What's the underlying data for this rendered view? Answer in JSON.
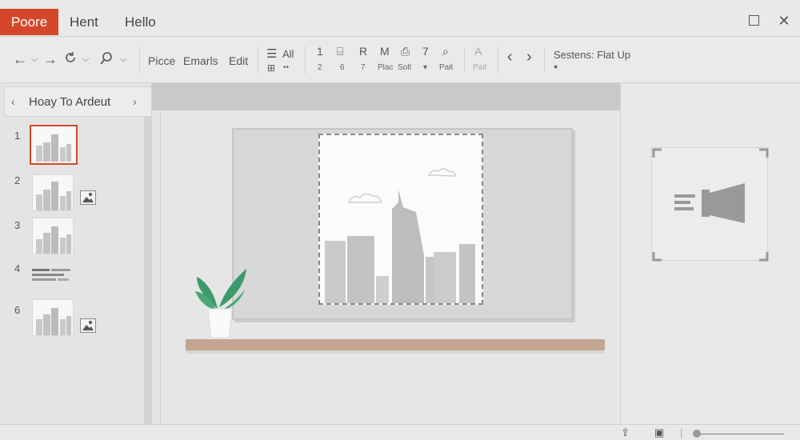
{
  "tabs": [
    {
      "label": "Poore",
      "active": true
    },
    {
      "label": "Hent"
    },
    {
      "label": "Hello"
    }
  ],
  "window": {
    "maximize_icon": "maximize-icon",
    "close_symbol": "✕"
  },
  "ribbon": {
    "nav_icons": [
      "back-arrow-icon",
      "forward-arrow-icon",
      "refresh-icon",
      "search-icon"
    ],
    "arrow_left": "←",
    "arrow_right": "→",
    "dropdown": "⌵",
    "menu": [
      "Picce",
      "Emarls",
      "Edit"
    ],
    "all_label": "All",
    "all_sub": "••",
    "tools": [
      {
        "glyph": "1",
        "sub": "2"
      },
      {
        "glyph": "⌸",
        "sub": "6"
      },
      {
        "glyph": "R",
        "sub": "7"
      },
      {
        "glyph": "M",
        "sub": "Plac"
      },
      {
        "glyph": "⎙",
        "sub": "Solt"
      },
      {
        "glyph": "7",
        "sub": "▾"
      },
      {
        "glyph": "⌕",
        "sub": "Pait"
      }
    ],
    "faded_glyph": "A",
    "faded_sub": "Pait",
    "nav_prev": "‹",
    "nav_next": "›",
    "session_text": "Sestens: Flat Up",
    "session_dot": "●"
  },
  "left_pane": {
    "title": "Hoay To Ardeut",
    "chev_left": "‹",
    "chev_right": "›",
    "slides": [
      {
        "number": "1",
        "selected": true
      },
      {
        "number": "2",
        "badge": true
      },
      {
        "number": "3"
      },
      {
        "number": "4",
        "text_slide": true
      },
      {
        "number": "6",
        "badge": true
      }
    ]
  },
  "colors": {
    "accent": "#d4472a",
    "shelf": "#c2a692",
    "leaf": "#3d9a6a"
  },
  "right_pane": {
    "card_icon": "megaphone-icon"
  },
  "statusbar": {
    "icons": [
      "share-icon",
      "view-icon"
    ],
    "zoom_icon": "zoom-slider"
  }
}
